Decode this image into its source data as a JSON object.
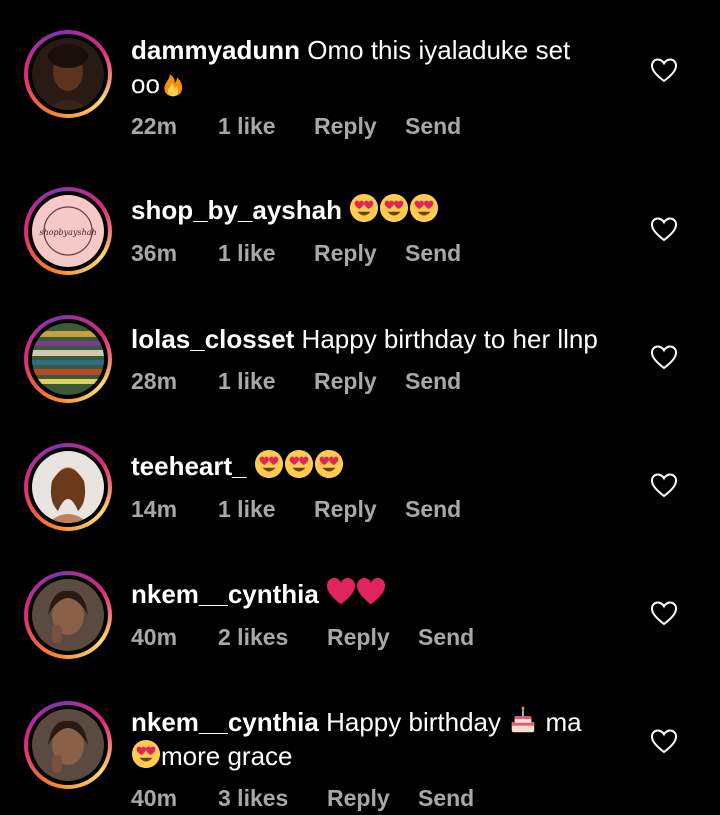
{
  "comments": [
    {
      "username": "dammyadunn",
      "text": "Omo this iyaladuke set",
      "text2": "oo",
      "time": "22m",
      "likes": "1 like",
      "reply": "Reply",
      "send": "Send",
      "avatar_icon": "person-photo"
    },
    {
      "username": "shop_by_ayshah",
      "text": "",
      "time": "36m",
      "likes": "1 like",
      "reply": "Reply",
      "send": "Send",
      "avatar_text": "shopbyayshah",
      "avatar_icon": "shop-logo"
    },
    {
      "username": "lolas_closset",
      "text": "Happy birthday to her llnp",
      "time": "28m",
      "likes": "1 like",
      "reply": "Reply",
      "send": "Send",
      "avatar_icon": "fabric-photo"
    },
    {
      "username": "teeheart_",
      "text": "",
      "time": "14m",
      "likes": "1 like",
      "reply": "Reply",
      "send": "Send",
      "avatar_icon": "person-photo"
    },
    {
      "username": "nkem__cynthia",
      "text": "",
      "time": "40m",
      "likes": "2 likes",
      "reply": "Reply",
      "send": "Send",
      "avatar_icon": "person-photo"
    },
    {
      "username": "nkem__cynthia",
      "text": "Happy birthday",
      "text_after_cake": "ma",
      "text2": "more grace",
      "time": "40m",
      "likes": "3 likes",
      "reply": "Reply",
      "send": "Send",
      "avatar_icon": "person-photo"
    }
  ],
  "colors": {
    "background": "#000000",
    "text": "#ffffff",
    "meta": "#a8a8a8"
  }
}
